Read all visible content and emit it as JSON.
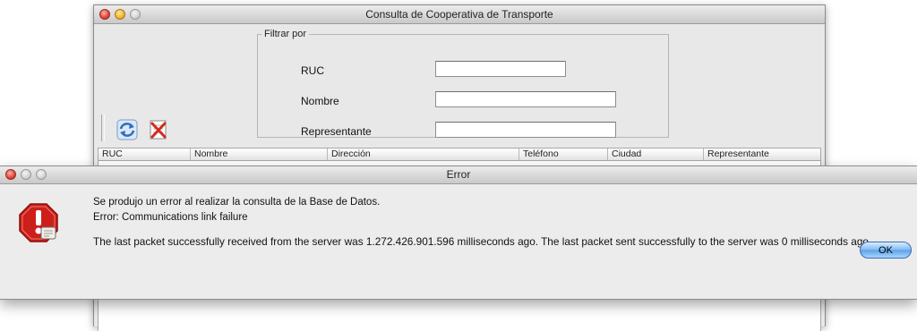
{
  "main_window": {
    "title": "Consulta de Cooperativa de Transporte",
    "filter": {
      "legend": "Filtrar por",
      "fields": [
        {
          "label": "RUC",
          "value": ""
        },
        {
          "label": "Nombre",
          "value": ""
        },
        {
          "label": "Representante",
          "value": ""
        }
      ]
    },
    "toolbar": {
      "refresh_icon": "refresh-icon",
      "clear_icon": "clear-filter-icon"
    },
    "table": {
      "columns": [
        "RUC",
        "Nombre",
        "Dirección",
        "Teléfono",
        "Ciudad",
        "Representante"
      ],
      "rows": []
    }
  },
  "error_dialog": {
    "title": "Error",
    "line1": "Se produjo un error al realizar la consulta de la Base de Datos.",
    "line2": "Error: Communications link failure",
    "line3": "The last packet successfully received from the server was 1.272.426.901.596 milliseconds ago.  The last packet sent successfully to the server was 0 milliseconds ago.",
    "ok_label": "OK",
    "icon": "stop-alert-icon"
  }
}
